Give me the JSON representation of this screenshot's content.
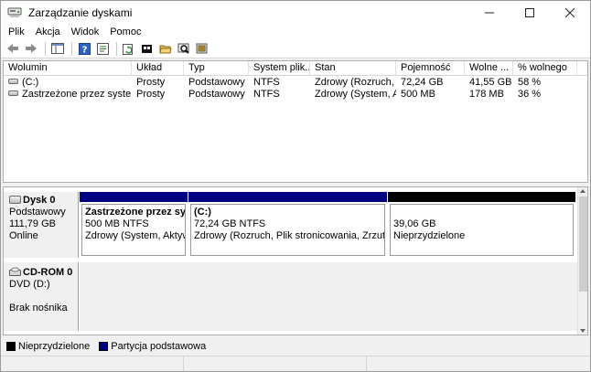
{
  "window": {
    "title": "Zarządzanie dyskami",
    "minimize": "—",
    "maximize": "☐",
    "close": "✕"
  },
  "menu": {
    "items": [
      {
        "label": "Plik"
      },
      {
        "label": "Akcja"
      },
      {
        "label": "Widok"
      },
      {
        "label": "Pomoc"
      }
    ]
  },
  "toolbar": {
    "icons": [
      "back-arrow-icon",
      "forward-arrow-icon",
      "show-hide-console-tree-icon",
      "help-icon",
      "properties-icon",
      "refresh-icon",
      "open-icon",
      "rescan-disks-icon",
      "settings-icon"
    ]
  },
  "volumes": {
    "columns": [
      "Wolumin",
      "Układ",
      "Typ",
      "System plik...",
      "Stan",
      "Pojemność",
      "Wolne ...",
      "% wolnego"
    ],
    "rows": [
      {
        "volume": "(C:)",
        "layout": "Prosty",
        "type": "Podstawowy",
        "fs": "NTFS",
        "status": "Zdrowy (Rozruch, ...",
        "capacity": "72,24 GB",
        "free": "41,55 GB",
        "pct_free": "58 %"
      },
      {
        "volume": "Zastrzeżone przez system",
        "layout": "Prosty",
        "type": "Podstawowy",
        "fs": "NTFS",
        "status": "Zdrowy (System, A...",
        "capacity": "500 MB",
        "free": "178 MB",
        "pct_free": "36 %"
      }
    ]
  },
  "disks": {
    "disk0": {
      "name": "Dysk 0",
      "type": "Podstawowy",
      "size": "111,79 GB",
      "state": "Online",
      "partitions": [
        {
          "name": "Zastrzeżone przez system",
          "info": "500 MB NTFS",
          "status": "Zdrowy (System, Aktywna, Partycja podstawowa)",
          "kind": "primary"
        },
        {
          "name": "(C:)",
          "info": "72,24 GB NTFS",
          "status": "Zdrowy (Rozruch, Plik stronicowania, Zrzut awaryjny, Partycja podstawowa)",
          "kind": "primary"
        },
        {
          "name": "",
          "info": "39,06 GB",
          "status": "Nieprzydzielone",
          "kind": "unallocated"
        }
      ]
    },
    "cdrom0": {
      "name": "CD-ROM 0",
      "drive": "DVD (D:)",
      "media": "Brak nośnika"
    }
  },
  "legend": {
    "unallocated": "Nieprzydzielone",
    "primary": "Partycja podstawowa",
    "colors": {
      "unallocated": "#000000",
      "primary": "#000080"
    }
  }
}
